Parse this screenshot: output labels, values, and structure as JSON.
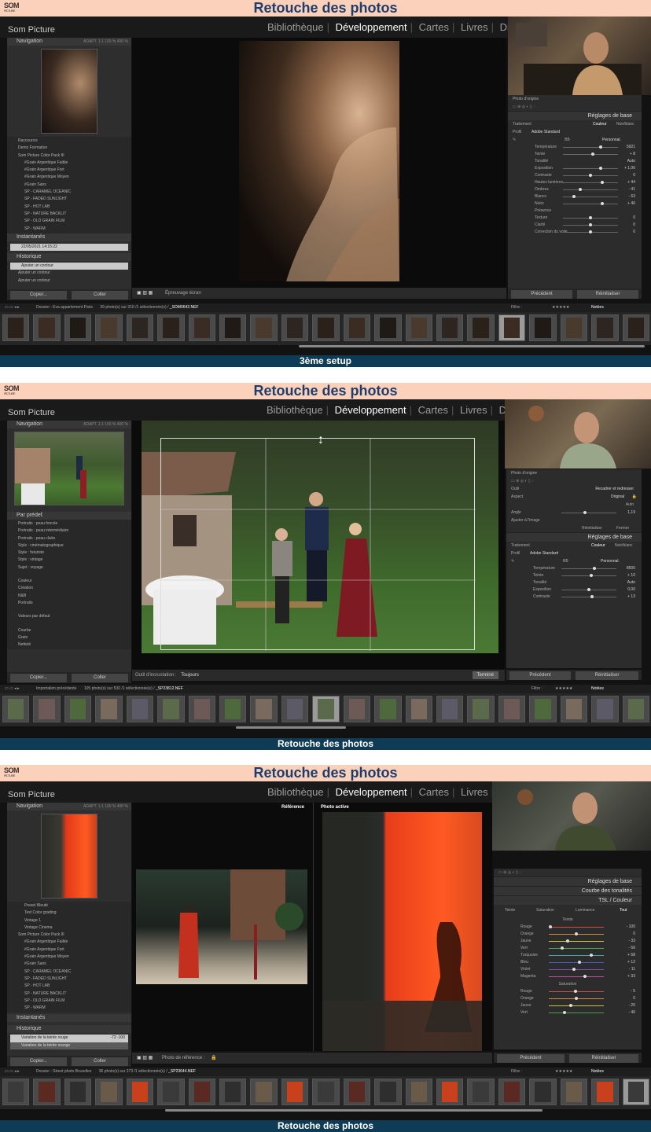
{
  "brand_logo": "SOM",
  "brand_logo_sub": "PICTURE",
  "app": {
    "brand": "Som Picture",
    "modules": [
      "Bibliothèque",
      "Développement",
      "Cartes",
      "Livres",
      "Diap"
    ],
    "active_module": "Développement"
  },
  "panels": [
    {
      "title": "Retouche des photos",
      "caption": "3ème setup",
      "navigator": {
        "label": "Navigation",
        "zoom": "ADAPT.  1:1  100 %  400 %"
      },
      "presets": [
        "Raccourcis",
        "Demo Formation",
        "Som Picture Color Pack III",
        "#Grain Argentique Faible",
        "#Grain Argentique Fort",
        "#Grain Argentique Moyen",
        "#Grain Sans",
        "SP - CARAMEL OCEANIC",
        "SP - FADED SUNLIGHT",
        "SP - HOT LAB",
        "SP - NATURE BACKLIT",
        "SP - OLD GRAIN FILM",
        "SP - WARM"
      ],
      "snapshots_label": "Instantanés",
      "snapshot_item": "22/05/2021 14:15:22",
      "history_label": "Historique",
      "history": [
        "Ajouter un contour",
        "Ajouter un contour",
        "Ajouter un contour"
      ],
      "copy_label": "Copier...",
      "paste_label": "Coller",
      "toolbar_text": "Épreuvage écran",
      "right": {
        "photo_origin": "Photo d'origine",
        "basic_header": "Réglages de base",
        "treatment": "Traitement",
        "color": "Couleur",
        "bw": "Noir/blanc",
        "profile_label": "Profil",
        "profile": "Adobe Standard",
        "wb_label": "BB",
        "wb_value": "Personnal.",
        "rows": [
          {
            "label": "Température",
            "value": "5921",
            "pos": 0.7
          },
          {
            "label": "Teinte",
            "value": "+ 8",
            "pos": 0.55
          },
          {
            "label": "Tonalité",
            "value": "Auto",
            "pos": -1
          },
          {
            "label": "Exposition",
            "value": "+ 1,06",
            "pos": 0.7
          },
          {
            "label": "Contraste",
            "value": "0",
            "pos": 0.5
          },
          {
            "label": "Hautes lumières",
            "value": "+ 44",
            "pos": 0.72
          },
          {
            "label": "Ombres",
            "value": "- 41",
            "pos": 0.3
          },
          {
            "label": "Blancs",
            "value": "- 63",
            "pos": 0.18
          },
          {
            "label": "Noirs",
            "value": "+ 46",
            "pos": 0.73
          },
          {
            "label": "Présence",
            "value": "",
            "pos": -1
          },
          {
            "label": "Texture",
            "value": "0",
            "pos": 0.5
          },
          {
            "label": "Clarté",
            "value": "0",
            "pos": 0.5
          },
          {
            "label": "Correction du voile",
            "value": "0",
            "pos": 0.5
          }
        ],
        "prev_label": "Précédent",
        "reset_label": "Réinitialiser"
      },
      "filmstrip": {
        "folder": "Dossier : Eva appartement Paris",
        "count": "39 photo(s) sur 316 /1 sélectionnée(s) /",
        "file": "_SOM0642.NEF",
        "filter_label": "Filtre :",
        "filter_value": "Notées"
      }
    },
    {
      "title": "Retouche des photos",
      "caption": "Retouche des photos",
      "navigator": {
        "label": "Navigation",
        "zoom": "ADAPT.  1:1  100 %  400 %"
      },
      "presets_label": "Par prédef.",
      "presets": [
        "Portraits : peau foncée",
        "Portraits : peau intermédiaire",
        "Portraits : peau claire",
        "Style : cinématographique",
        "Style : futuriste",
        "Style : vintage",
        "Sujet : voyage",
        "Couleur",
        "Création",
        "N&B",
        "Portraits",
        "Valeurs par défaut",
        "Courbe",
        "Grain",
        "Netteté"
      ],
      "copy_label": "Copier...",
      "paste_label": "Coller",
      "toolbar_text": "Outil d'incrustation :",
      "toolbar_value": "Toujours",
      "done_label": "Terminé",
      "right": {
        "photo_origin": "Photo d'origine",
        "tool_label": "Outil",
        "tool_value": "Recadrer et redresser",
        "aspect_label": "Aspect",
        "aspect_value": "Original",
        "auto": "Auto",
        "angle_label": "Angle",
        "angle_value": "1,19",
        "fit_label": "Ajuster à l'image",
        "reset_crop": "Réinitialiser",
        "close_crop": "Fermer",
        "basic_header": "Réglages de base",
        "treatment": "Traitement",
        "color": "Couleur",
        "bw": "Noir/blanc",
        "profile_label": "Profil",
        "profile": "Adobe Standard",
        "wb_label": "BB",
        "wb_value": "Personnal.",
        "rows": [
          {
            "label": "Température",
            "value": "8500",
            "pos": 0.6
          },
          {
            "label": "Teinte",
            "value": "+ 10",
            "pos": 0.55
          },
          {
            "label": "Tonalité",
            "value": "Auto",
            "pos": -1
          },
          {
            "label": "Exposition",
            "value": "0,00",
            "pos": 0.5
          },
          {
            "label": "Contraste",
            "value": "+ 13",
            "pos": 0.56
          }
        ],
        "prev_label": "Précédent",
        "reset_label": "Réinitialiser"
      },
      "filmstrip": {
        "folder": "Importation précédente",
        "count": "105 photo(s) sur 530 /1 sélectionnée(s) /",
        "file": "_SP23812.NEF",
        "filter_label": "Filtre :",
        "filter_value": "Notées"
      }
    },
    {
      "title": "Retouche des photos",
      "caption": "Retouche des photos",
      "navigator": {
        "label": "Navigation",
        "zoom": "ADAPT.  1:1  100 %  400 %"
      },
      "presets": [
        "Preset Bleuté",
        "Test Color grading",
        "Vintage 1",
        "Vintage Cinema",
        "Som Picture Color Pack III",
        "#Grain Argentique Faible",
        "#Grain Argentique Fort",
        "#Grain Argentique Moyen",
        "#Grain Sans",
        "SP - CARAMEL OCEANIC",
        "SP - FADED SUNLIGHT",
        "SP - HOT LAB",
        "SP - NATURE BACKLIT",
        "SP - OLD GRAIN FILM",
        "SP - WARM"
      ],
      "snapshots_label": "Instantanés",
      "history_label": "Historique",
      "history": [
        "Variation de la teinte rouge",
        "Variation de la teinte orange"
      ],
      "history_vals": "-72   -100",
      "copy_label": "Copier...",
      "paste_label": "Coller",
      "ref_label": "Référence",
      "active_label": "Photo active",
      "toolbar_text": "Photo de référence :",
      "right": {
        "basic_header": "Réglages de base",
        "curve_header": "Courbe des tonalités",
        "hsl_header": "TSL / Couleur",
        "tabs": [
          "Teinte",
          "Saturation",
          "Luminance",
          "Tout"
        ],
        "hue_label": "Teinte",
        "hue_rows": [
          {
            "label": "Rouge",
            "value": "- 100",
            "pos": 0.0
          },
          {
            "label": "Orange",
            "value": "0",
            "pos": 0.5
          },
          {
            "label": "Jaune",
            "value": "- 33",
            "pos": 0.34
          },
          {
            "label": "Vert",
            "value": "- 56",
            "pos": 0.22
          },
          {
            "label": "Turquoise",
            "value": "+ 58",
            "pos": 0.79
          },
          {
            "label": "Bleu",
            "value": "+ 12",
            "pos": 0.56
          },
          {
            "label": "Violet",
            "value": "- 11",
            "pos": 0.45
          },
          {
            "label": "Magenta",
            "value": "+ 33",
            "pos": 0.66
          }
        ],
        "sat_label": "Saturation",
        "sat_rows": [
          {
            "label": "Rouge",
            "value": "- 5",
            "pos": 0.48
          },
          {
            "label": "Orange",
            "value": "0",
            "pos": 0.5
          },
          {
            "label": "Jaune",
            "value": "- 20",
            "pos": 0.4
          },
          {
            "label": "Vert",
            "value": "- 46",
            "pos": 0.27
          }
        ],
        "prev_label": "Précédent",
        "reset_label": "Réinitialiser"
      },
      "filmstrip": {
        "folder": "Dossier : Street photo Bruxelles",
        "count": "36 photo(s) sur 273 /1 sélectionnée(s) /",
        "file": "_SP23644.NEF",
        "filter_label": "Filtre :",
        "filter_value": "Notées"
      }
    }
  ]
}
